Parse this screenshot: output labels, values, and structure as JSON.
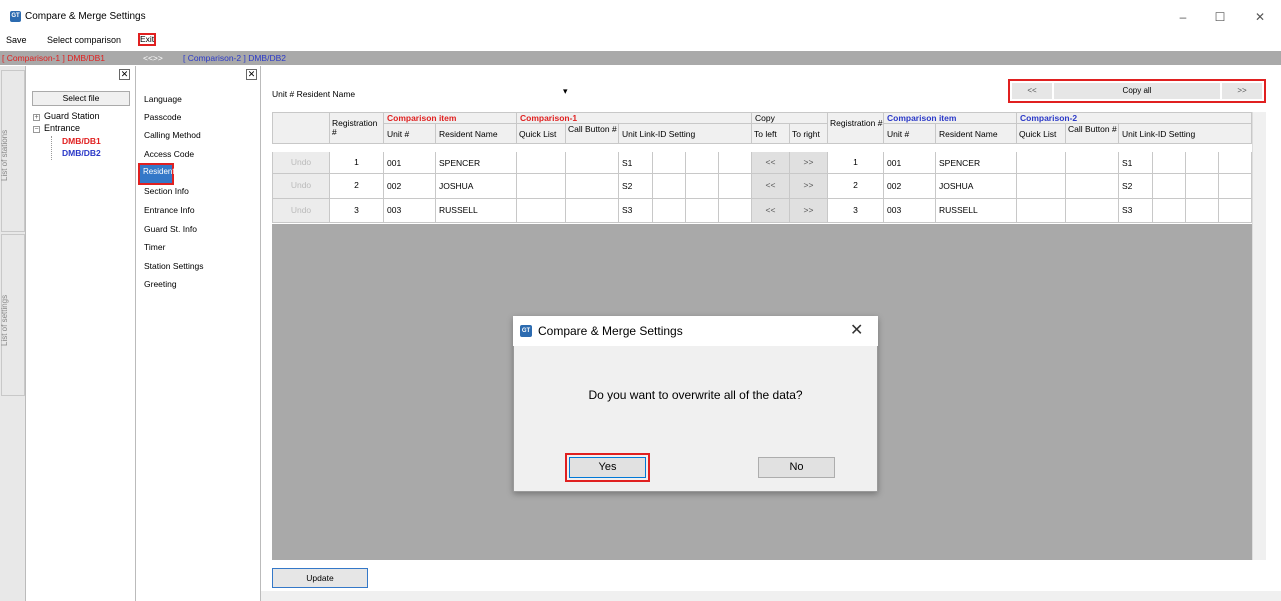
{
  "window": {
    "title": "Compare & Merge Settings",
    "icon_text": "GT",
    "minimize": "–",
    "maximize": "☐",
    "close": "✕"
  },
  "menu": {
    "save": "Save",
    "select_comparison": "Select comparison",
    "exit": "Exit"
  },
  "comparison_bar": {
    "c1": "[ Comparison-1 ] DMB/DB1",
    "arrows": "<<>>",
    "c2": "[ Comparison-2 ] DMB/DB2"
  },
  "vtabs": {
    "stations": "List of stations",
    "settings": "List of settings"
  },
  "station_panel": {
    "select_file": "Select file",
    "tree": {
      "guard_station": "Guard Station",
      "entrance": "Entrance",
      "db1": "DMB/DB1",
      "db2": "DMB/DB2"
    }
  },
  "settings_list": [
    "Language",
    "Passcode",
    "Calling Method",
    "Access Code",
    "Resident",
    "Section Info",
    "Entrance Info",
    "Guard St. Info",
    "Timer",
    "Station Settings",
    "Greeting"
  ],
  "main": {
    "filter_label": "Unit # Resident Name",
    "filter_arrow": "▾",
    "copy_prev": "<<",
    "copy_all": "Copy all",
    "copy_next": ">>",
    "update": "Update"
  },
  "table": {
    "registration": "Registration #",
    "comparison_item": "Comparison item",
    "comparison1": "Comparison-1",
    "copy": "Copy",
    "comparison2": "Comparison-2",
    "unit": "Unit #",
    "resident_name": "Resident Name",
    "quick_list": "Quick List",
    "call_button": "Call Button #",
    "unit_link": "Unit Link-ID Setting",
    "to_left": "To left",
    "to_right": "To right",
    "undo": "Undo",
    "left_btn": "<<",
    "right_btn": ">>",
    "rows": [
      {
        "reg": "1",
        "unit": "001",
        "name": "SPENCER",
        "link": "S1"
      },
      {
        "reg": "2",
        "unit": "002",
        "name": "JOSHUA",
        "link": "S2"
      },
      {
        "reg": "3",
        "unit": "003",
        "name": "RUSSELL",
        "link": "S3"
      }
    ]
  },
  "dialog": {
    "title": "Compare & Merge Settings",
    "icon_text": "GT",
    "close": "✕",
    "message": "Do you want to overwrite all of the data?",
    "yes": "Yes",
    "no": "No"
  }
}
